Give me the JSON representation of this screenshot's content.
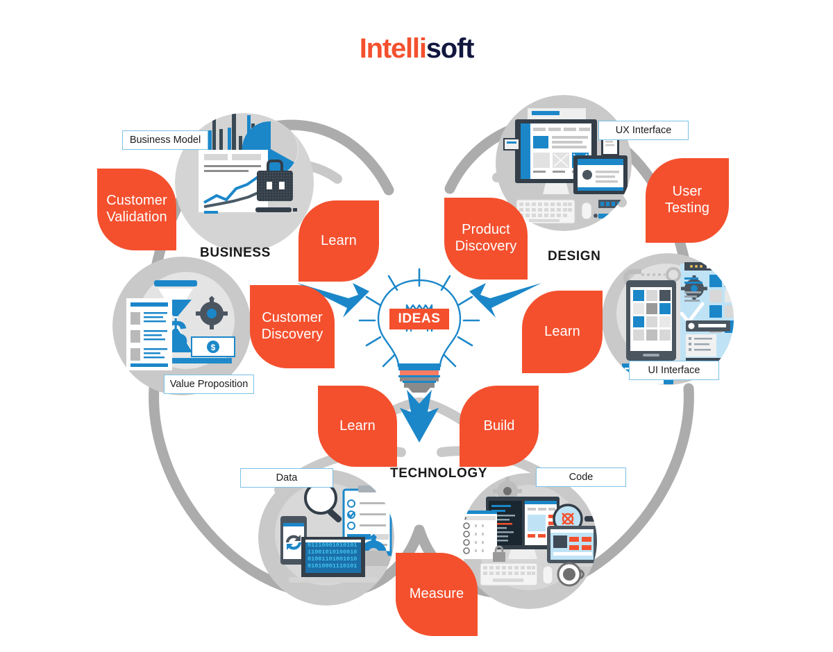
{
  "logo": {
    "part1": "Intelli",
    "part2": "soft"
  },
  "center": {
    "label": "IDEAS"
  },
  "colors": {
    "brand_orange": "#F4502E",
    "brand_navy": "#12173F",
    "accent_blue": "#1B87C9",
    "ring_gray": "#ACACAC",
    "circle_gray": "#C9C9C9",
    "chip_border": "#79C0E8"
  },
  "pillars": [
    {
      "id": "business",
      "label": "BUSINESS"
    },
    {
      "id": "design",
      "label": "DESIGN"
    },
    {
      "id": "technology",
      "label": "TECHNOLOGY"
    }
  ],
  "leaves": [
    {
      "id": "customer-validation",
      "label": "Customer\nValidation"
    },
    {
      "id": "learn-business",
      "label": "Learn"
    },
    {
      "id": "product-discovery",
      "label": "Product\nDiscovery"
    },
    {
      "id": "user-testing",
      "label": "User\nTesting"
    },
    {
      "id": "customer-discovery",
      "label": "Customer\nDiscovery"
    },
    {
      "id": "learn-design",
      "label": "Learn"
    },
    {
      "id": "learn-technology",
      "label": "Learn"
    },
    {
      "id": "build",
      "label": "Build"
    },
    {
      "id": "measure",
      "label": "Measure"
    }
  ],
  "chips": [
    {
      "id": "business-model",
      "label": "Business Model"
    },
    {
      "id": "ux-interface",
      "label": "UX Interface"
    },
    {
      "id": "value-proposition",
      "label": "Value Proposition"
    },
    {
      "id": "ui-interface",
      "label": "UI Interface"
    },
    {
      "id": "data",
      "label": "Data"
    },
    {
      "id": "code",
      "label": "Code"
    }
  ],
  "illustrations": {
    "binary_lines": [
      "01110001010101",
      "11001010100010",
      "01001101001010",
      "01010001110101"
    ]
  },
  "chart_data": {
    "type": "diagram",
    "title": "Lean Startup Build-Measure-Learn across Business, Design and Technology",
    "center_node": "IDEAS",
    "arrows": [
      {
        "from": "IDEAS",
        "to": "BUSINESS",
        "direction": "up-left"
      },
      {
        "from": "IDEAS",
        "to": "DESIGN",
        "direction": "up-right"
      },
      {
        "from": "IDEAS",
        "to": "TECHNOLOGY",
        "direction": "down"
      }
    ],
    "groups": [
      {
        "name": "BUSINESS",
        "activities": [
          "Customer Validation",
          "Learn",
          "Customer Discovery"
        ],
        "artifacts": [
          "Business Model",
          "Value Proposition"
        ]
      },
      {
        "name": "DESIGN",
        "activities": [
          "Product Discovery",
          "User Testing",
          "Learn"
        ],
        "artifacts": [
          "UX Interface",
          "UI Interface"
        ]
      },
      {
        "name": "TECHNOLOGY",
        "activities": [
          "Learn",
          "Build",
          "Measure"
        ],
        "artifacts": [
          "Data",
          "Code"
        ]
      }
    ]
  }
}
